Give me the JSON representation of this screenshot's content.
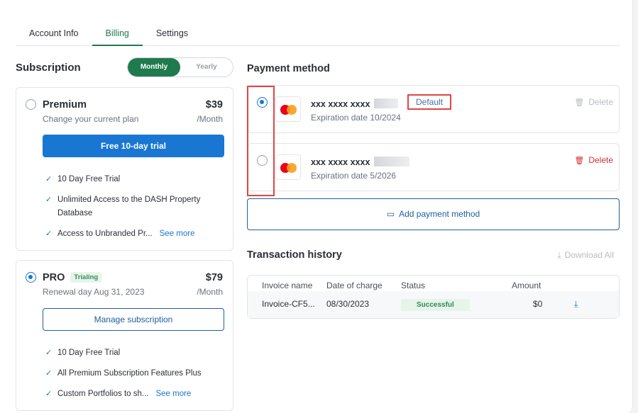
{
  "tabs": [
    {
      "label": "Account Info",
      "active": false
    },
    {
      "label": "Billing",
      "active": true
    },
    {
      "label": "Settings",
      "active": false
    }
  ],
  "subscription": {
    "title": "Subscription",
    "toggle": {
      "monthly": "Monthly",
      "yearly": "Yearly",
      "selected": "Monthly"
    },
    "plans": [
      {
        "name": "Premium",
        "price": "$39",
        "per": "/Month",
        "subtitle": "Change your current plan",
        "button": "Free 10-day trial",
        "selected": false,
        "features": [
          "10 Day Free Trial",
          "Unlimited Access to the DASH Property Database",
          "Access to Unbranded Pr..."
        ],
        "see_more": "See more"
      },
      {
        "name": "PRO",
        "badge": "Trialing",
        "price": "$79",
        "per": "/Month",
        "subtitle": "Renewal day Aug 31, 2023",
        "button": "Manage subscription",
        "selected": true,
        "features": [
          "10 Day Free Trial",
          "All Premium Subscription Features Plus",
          "Custom Portfolios to sh..."
        ],
        "see_more": "See more"
      }
    ]
  },
  "payment": {
    "title": "Payment method",
    "cards": [
      {
        "number": "xxx xxxx xxxx",
        "expiration": "Expiration date 10/2024",
        "default_label": "Default",
        "delete": "Delete",
        "selected": true,
        "delete_enabled": false
      },
      {
        "number": "xxx xxxx xxxx",
        "expiration": "Expiration date 5/2026",
        "delete": "Delete",
        "selected": false,
        "delete_enabled": true
      }
    ],
    "add_label": "Add payment method"
  },
  "transactions": {
    "title": "Transaction history",
    "download_all": "Download All",
    "columns": [
      "Invoice name",
      "Date of charge",
      "Status",
      "Amount"
    ],
    "rows": [
      {
        "invoice": "Invoice-CF5...",
        "date": "08/30/2023",
        "status": "Successful",
        "amount": "$0"
      }
    ]
  },
  "colors": {
    "brand_green": "#1f7a4d",
    "primary_blue": "#1976d2",
    "danger_red": "#d32f2f",
    "highlight_red": "#e04545"
  },
  "icons": {
    "check": "check-icon",
    "trash": "trash-icon",
    "card": "credit-card-icon",
    "download": "download-icon",
    "mastercard": "mastercard-logo"
  }
}
